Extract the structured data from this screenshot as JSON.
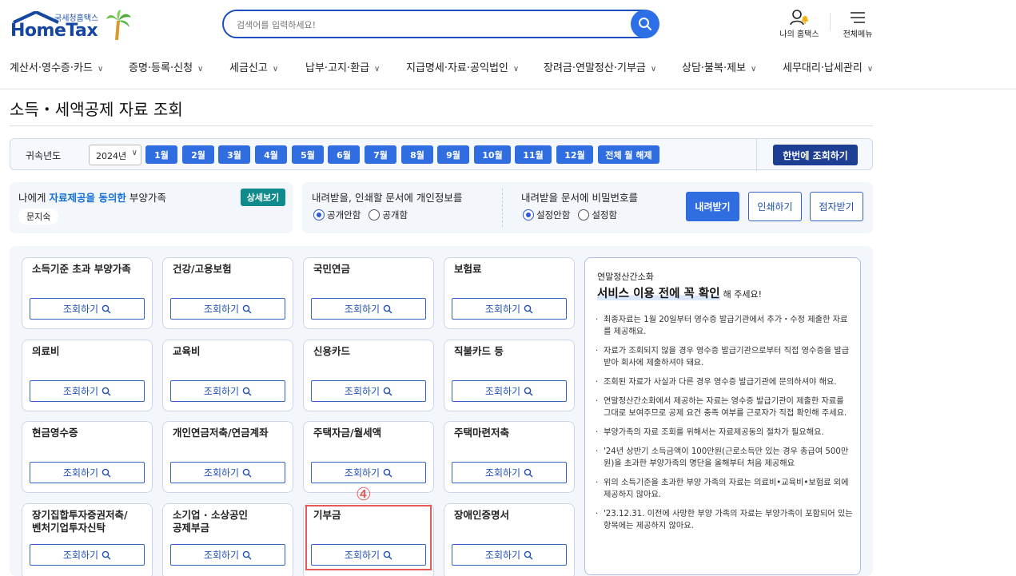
{
  "header": {
    "logo_small": "국세청홈택스",
    "logo_big": "HomeTax",
    "search_placeholder": "검색어를 입력하세요!",
    "my_hometax": "나의 홈택스",
    "all_menu": "전체메뉴"
  },
  "gnb": [
    {
      "label": "계산서·영수증·카드"
    },
    {
      "label": "증명·등록·신청"
    },
    {
      "label": "세금신고"
    },
    {
      "label": "납부·고지·환급"
    },
    {
      "label": "지급명세·자료·공익법인"
    },
    {
      "label": "장려금·연말정산·기부금"
    },
    {
      "label": "상담·불복·제보"
    },
    {
      "label": "세무대리·납세관리"
    }
  ],
  "page_title": "소득・세액공제 자료 조회",
  "filter": {
    "label": "귀속년도",
    "year": "2024년",
    "months": [
      "1월",
      "2월",
      "3월",
      "4월",
      "5월",
      "6월",
      "7월",
      "8월",
      "9월",
      "10월",
      "11월",
      "12월"
    ],
    "clear_all": "전체 월 해제",
    "query_all": "한번에 조회하기"
  },
  "dependents": {
    "prefix": "나에게 ",
    "highlight": "자료제공을 동의한",
    "suffix": " 부양가족",
    "detail_btn": "상세보기",
    "person": "문지숙"
  },
  "privacy": {
    "question": "내려받을, 인쇄할 문서에 개인정보를",
    "opt_private": "공개안함",
    "opt_public": "공개함"
  },
  "password": {
    "question": "내려받을 문서에 비밀번호를",
    "opt_no": "설정안함",
    "opt_yes": "설정함"
  },
  "actions": {
    "download": "내려받기",
    "print": "인쇄하기",
    "braille": "점자받기"
  },
  "query_label": "조회하기",
  "cards": [
    {
      "title": "소득기준 초과 부양가족"
    },
    {
      "title": "건강/고용보험"
    },
    {
      "title": "국민연금"
    },
    {
      "title": "보험료"
    },
    {
      "title": "의료비"
    },
    {
      "title": "교육비"
    },
    {
      "title": "신용카드"
    },
    {
      "title": "직불카드 등"
    },
    {
      "title": "현금영수증"
    },
    {
      "title": "개인연금저축/연금계좌"
    },
    {
      "title": "주택자금/월세액"
    },
    {
      "title": "주택마련저축"
    },
    {
      "title": "장기집합투자증권저축/",
      "title2": "벤처기업투자신탁"
    },
    {
      "title": "소기업 · 소상공인",
      "title2": "공제부금"
    },
    {
      "title": "기부금"
    },
    {
      "title": "장애인증명서"
    }
  ],
  "annotation_marker": "④",
  "notice": {
    "sub": "연말정산간소화",
    "head": "서비스 이용 전에 꼭 확인",
    "head_tail": "해 주세요!",
    "items": [
      "최종자료는 1월 20일부터 영수증 발급기관에서 추가・수정 제출한 자료를 제공해요.",
      "자료가 조회되지 않을 경우 영수증 발급기관으로부터 직접 영수증을 발급받아 회사에 제출하셔야 돼요.",
      "조회된 자료가 사실과 다른 경우 영수증 발급기관에 문의하셔야 해요.",
      "연말정산간소화에서 제공하는 자료는 영수증 발급기관이 제출한 자료를 그대로 보여주므로 공제 요건 충족 여부를 근로자가 직접 확인해 주세요.",
      "부양가족의 자료 조회를 위해서는 자료제공동의 절차가 필요해요.",
      "'24년 상반기 소득금액이 100만원(근로소득만 있는 경우 총급여 500만원)을 초과한 부양가족의 명단을 올해부터 처음 제공해요",
      "위의 소득기준을 초과한 부양 가족의 자료는 의료비•교육비•보험료 외에 제공하지 않아요.",
      "'23.12.31. 이전에 사망한 부양 가족의 자료는 부양가족이 포함되어 있는 항목에는 제공하지 않아요."
    ]
  }
}
